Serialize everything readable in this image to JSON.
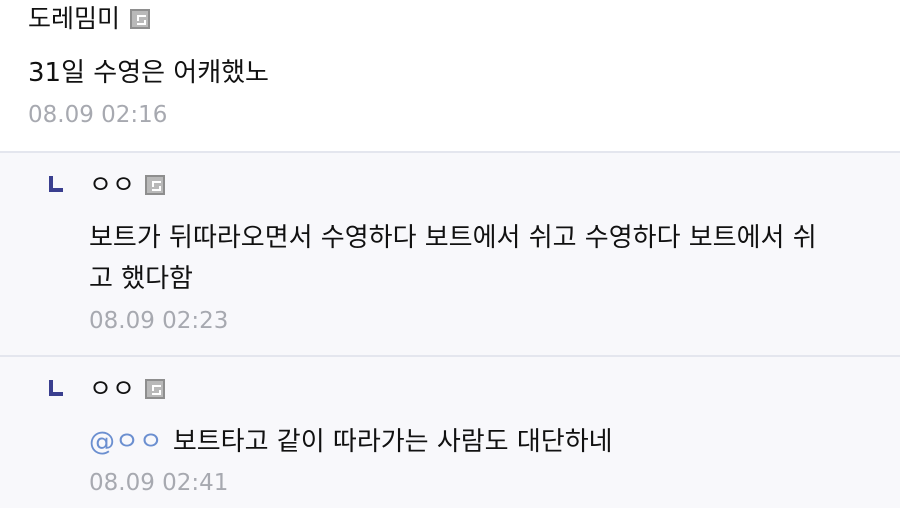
{
  "comments": [
    {
      "author": "도레밈미",
      "author_badge_icon": "fixed-nick-badge-icon",
      "text": "31일 수영은 어캐했노",
      "timestamp": "08.09 02:16"
    }
  ],
  "replies": [
    {
      "reply_marker_icon": "reply-corner-icon",
      "author": "ㅇㅇ",
      "author_badge_icon": "fixed-nick-badge-icon",
      "text_line1": "보트가 뒤따라오면서 수영하다 보트에서 쉬고 수영하다 보트에서 쉬",
      "text_line2": "고 했다함",
      "timestamp": "08.09 02:23"
    },
    {
      "reply_marker_icon": "reply-corner-icon",
      "author": "ㅇㅇ",
      "author_badge_icon": "fixed-nick-badge-icon",
      "mention": "@ㅇㅇ",
      "text": "보트타고 같이 따라가는 사람도 대단하네",
      "timestamp": "08.09 02:41"
    }
  ],
  "colors": {
    "reply_marker": "#3a3f8f",
    "mention": "#6b8fd0",
    "timestamp": "#a7a9b0",
    "reply_background": "#f8f8fb",
    "divider": "#e4e6ee"
  }
}
